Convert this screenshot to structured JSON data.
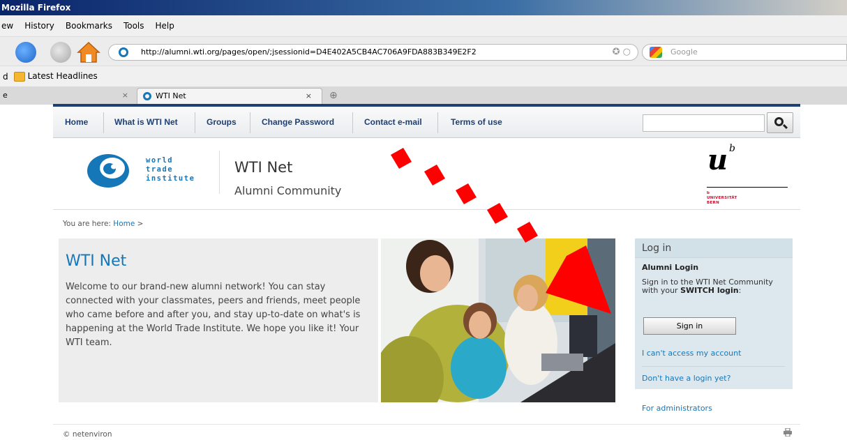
{
  "browser": {
    "window_title": "Mozilla Firefox",
    "menu": [
      "ew",
      "History",
      "Bookmarks",
      "Tools",
      "Help"
    ],
    "url": "http://alumni.wti.org/pages/open/;jsessionid=D4E402A5CB4AC706A9FDA883B349E2F2",
    "search_placeholder": "Google",
    "bookmarks": {
      "prefix": "d",
      "latest_headlines": "Latest Headlines"
    },
    "tabs": {
      "prev_label": "e",
      "active_label": "WTI Net",
      "close": "×",
      "new_tab": "⊕"
    }
  },
  "site_nav": {
    "items": [
      "Home",
      "What is WTI Net",
      "Groups",
      "Change Password",
      "Contact e-mail",
      "Terms of use"
    ],
    "search_value": ""
  },
  "header": {
    "logo_lines": [
      "world",
      "trade",
      "institute"
    ],
    "title": "WTI Net",
    "subtitle": "Alumni Community",
    "unibe_letter": "u",
    "unibe_superscript": "b",
    "unibe_text_1": "b",
    "unibe_text_2": "UNIVERSITÄT",
    "unibe_text_3": "BERN"
  },
  "breadcrumb": {
    "label": "You are here:",
    "home": "Home",
    "sep": ">"
  },
  "intro": {
    "title": "WTI Net",
    "text": "Welcome to our brand-new alumni network! You can stay connected with your classmates, peers and friends, meet people who came before and after you, and stay up-to-date on what's is happening at the World Trade Institute. We hope you like it! Your WTI team."
  },
  "login": {
    "heading": "Log in",
    "sub": "Alumni Login",
    "desc_prefix": "Sign in to the WTI Net Community with your ",
    "desc_bold": "SWITCH login",
    "desc_suffix": ":",
    "sign_in": "Sign in",
    "cant_access": "I can't access my account",
    "no_login": "Don't have a login yet?",
    "for_admins": "For administrators"
  },
  "footer": {
    "copyright": "© netenviron"
  },
  "colors": {
    "brand_blue": "#1576b8",
    "nav_dark": "#1e3f73",
    "arrow_red": "#ff0000",
    "unibe_red": "#c8102e"
  },
  "icons": [
    "reload-icon",
    "stop-icon",
    "home-icon",
    "site-identity-icon",
    "google-icon",
    "folder-icon",
    "search-icon",
    "print-icon",
    "red-arrow"
  ]
}
